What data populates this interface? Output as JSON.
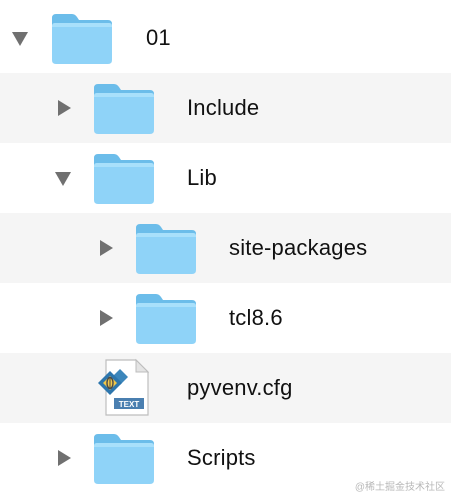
{
  "items": [
    {
      "label": "01",
      "expanded": true,
      "type": "folder"
    },
    {
      "label": "Include",
      "expanded": false,
      "type": "folder"
    },
    {
      "label": "Lib",
      "expanded": true,
      "type": "folder"
    },
    {
      "label": "site-packages",
      "expanded": false,
      "type": "folder"
    },
    {
      "label": "tcl8.6",
      "expanded": false,
      "type": "folder"
    },
    {
      "label": "pyvenv.cfg",
      "type": "text-file",
      "badge": "TEXT"
    },
    {
      "label": "Scripts",
      "expanded": false,
      "type": "folder"
    }
  ],
  "colors": {
    "folder_front": "#8fd3f8",
    "folder_back": "#6cbdea",
    "disclosure_triangle": "#707070",
    "row_alternate": "#f5f5f5"
  },
  "watermark": "@稀土掘金技术社区"
}
